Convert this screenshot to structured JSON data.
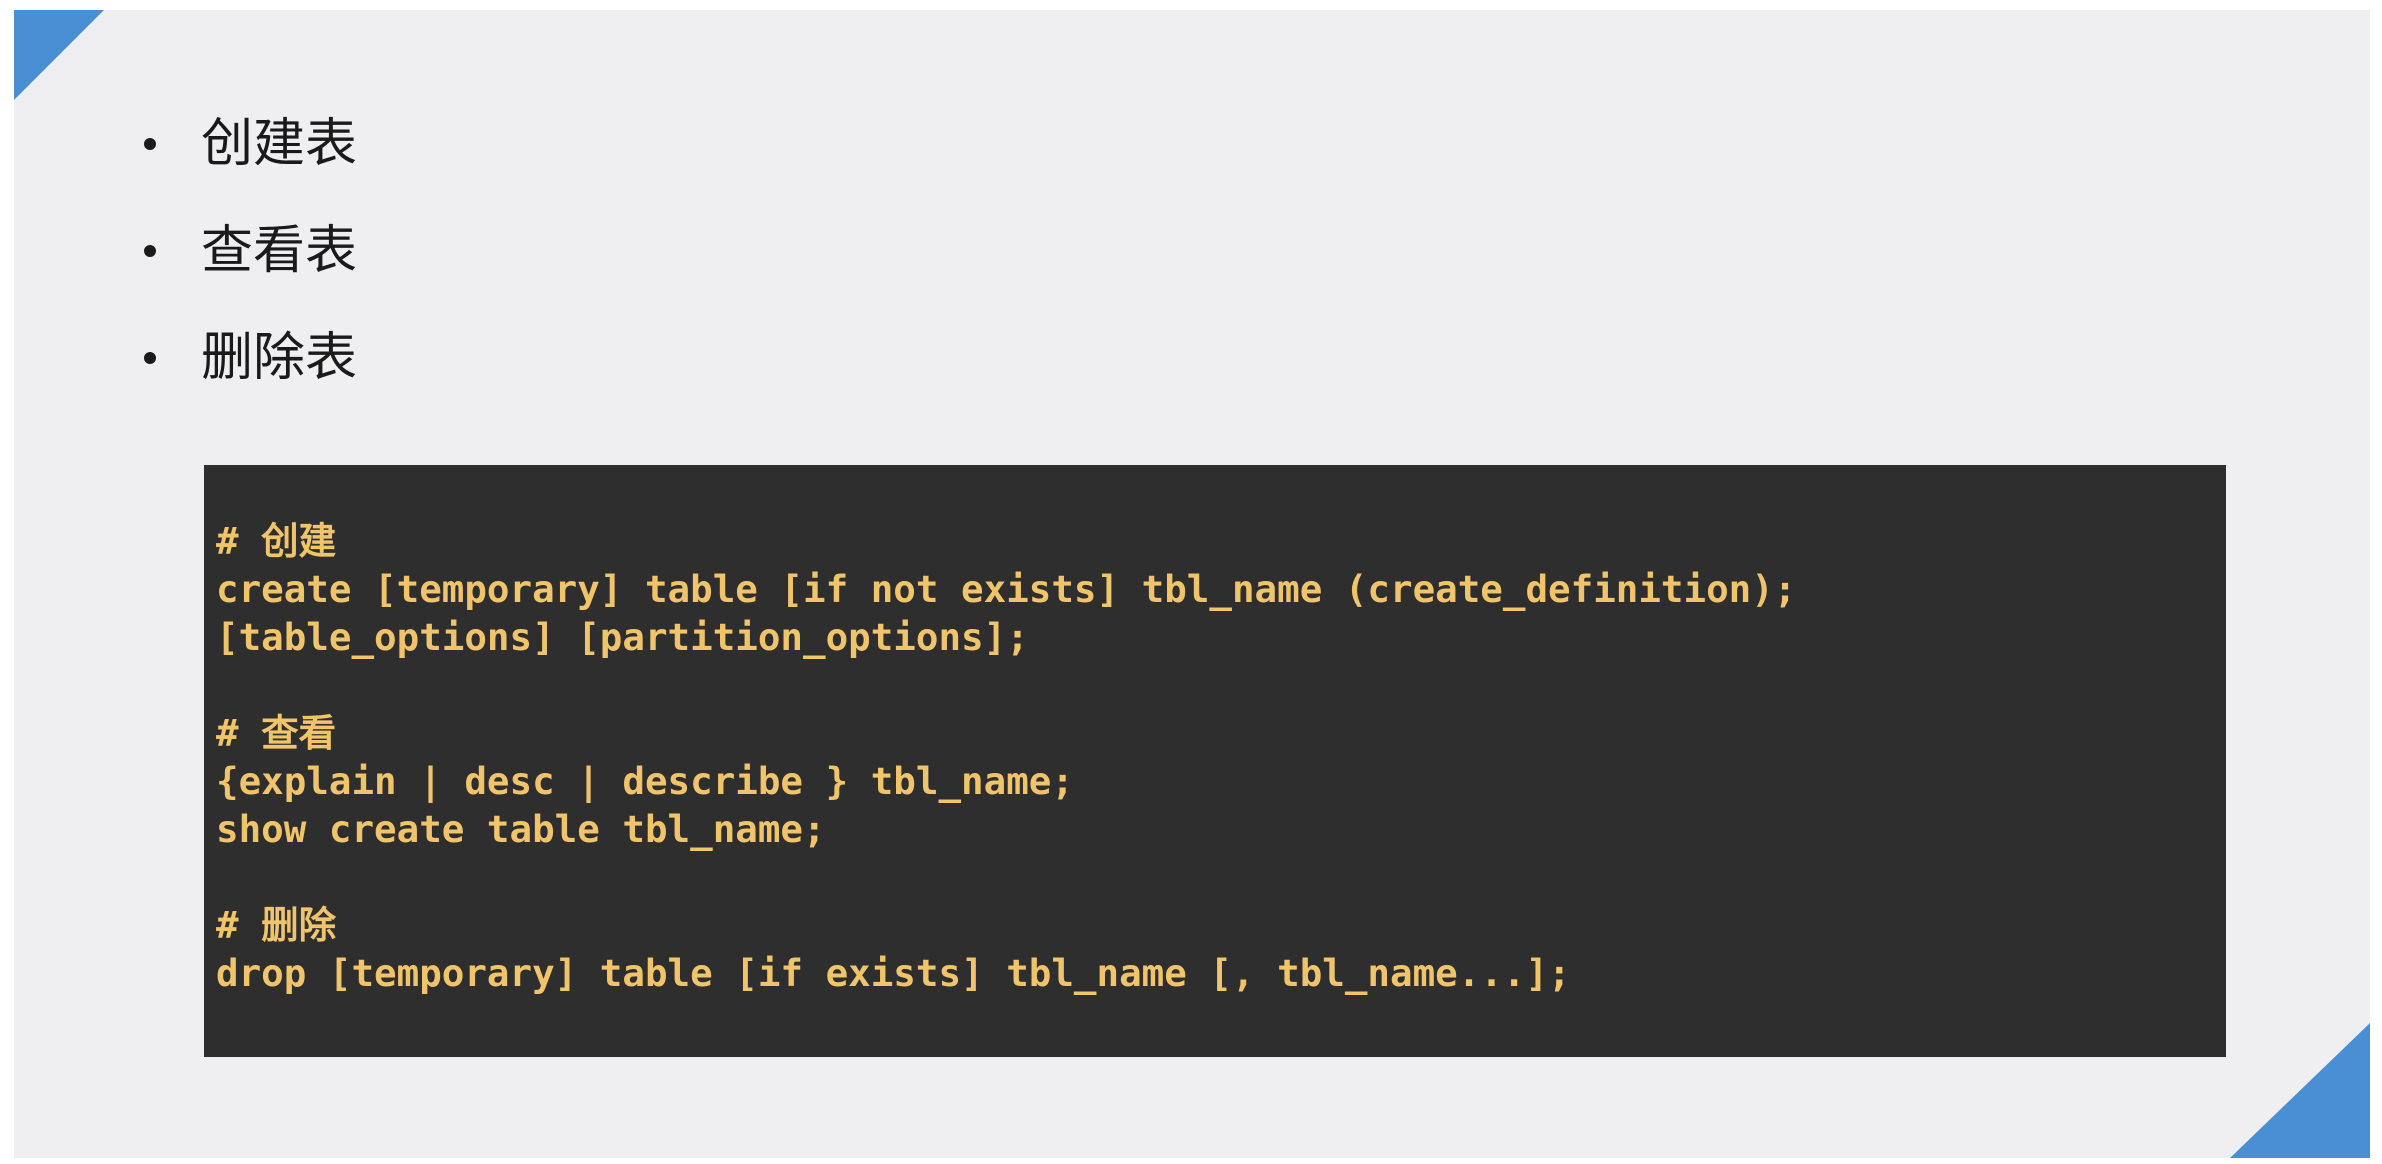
{
  "bullets": [
    {
      "label": "创建表"
    },
    {
      "label": "查看表"
    },
    {
      "label": "删除表"
    }
  ],
  "code": {
    "lines": [
      "# 创建",
      "create [temporary] table [if not exists] tbl_name (create_definition);",
      "[table_options] [partition_options];",
      "",
      "# 查看",
      "{explain | desc | describe } tbl_name;",
      "show create table tbl_name;",
      "",
      "# 删除",
      "drop [temporary] table [if exists] tbl_name [, tbl_name...];"
    ]
  },
  "colors": {
    "accent": "#4a8fd4",
    "slide_background": "#efeff2",
    "code_background": "#2e2e2e",
    "code_text": "#f0c46a"
  }
}
